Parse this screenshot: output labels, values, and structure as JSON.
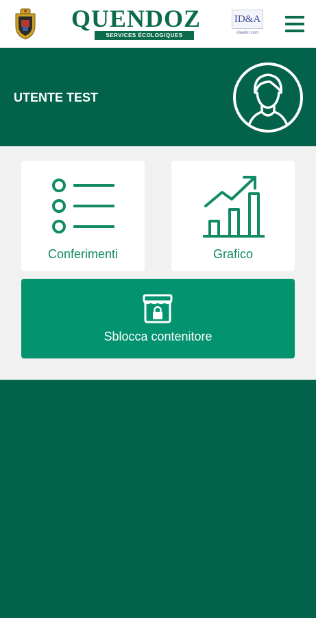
{
  "header": {
    "brand_name": "QUENDOZ",
    "brand_tagline": "SERVICES ÉCOLOGIQUES",
    "partner_logo_text": "ID&A",
    "partner_logo_subtext": "idaalim.com",
    "crest_icon": "municipal-crest-icon",
    "menu_icon": "hamburger-menu-icon"
  },
  "profile": {
    "user_name": "UTENTE TEST",
    "avatar_icon": "user-avatar-icon"
  },
  "cards": [
    {
      "label": "Conferimenti",
      "icon": "list-icon"
    },
    {
      "label": "Grafico",
      "icon": "bar-chart-trend-icon"
    }
  ],
  "unlock_button": {
    "label": "Sblocca contenitore",
    "icon": "locked-container-icon"
  },
  "colors": {
    "primary_dark": "#02634a",
    "primary_button": "#03936e",
    "accent_text": "#128a66",
    "panel_bg": "#f1f1f1"
  }
}
